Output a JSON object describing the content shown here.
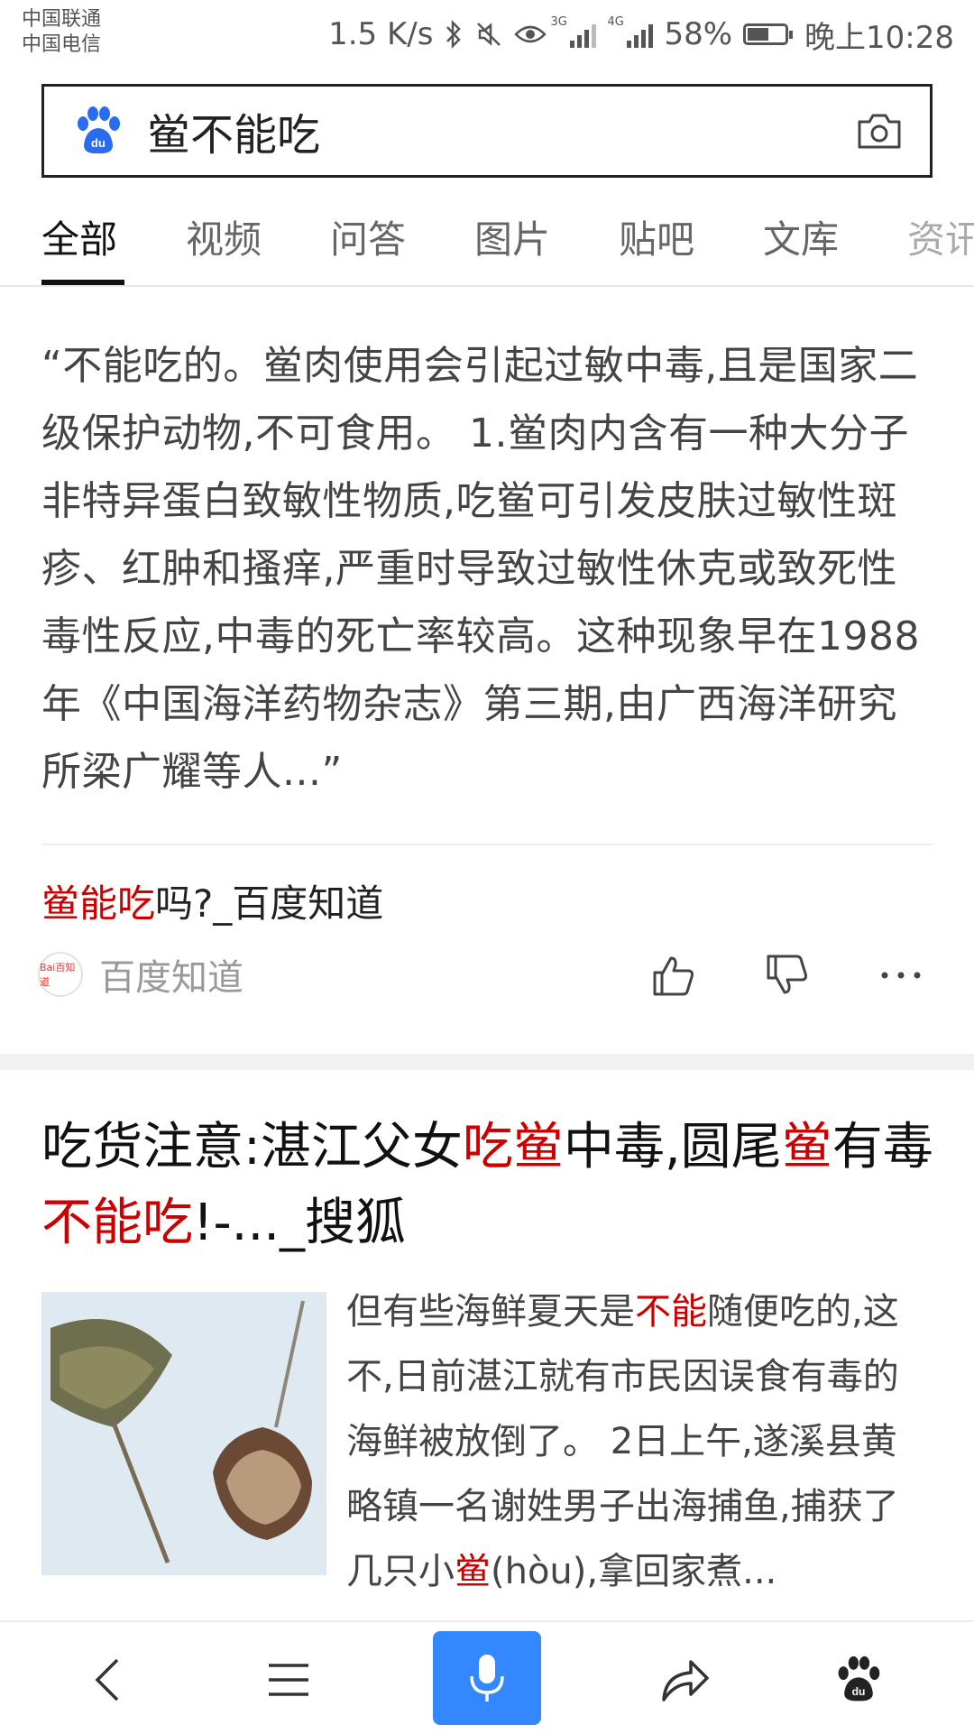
{
  "status_bar": {
    "carrier_1": "中国联通",
    "carrier_2": "中国电信",
    "net_speed": "1.5 K/s",
    "network_3g": "3G",
    "network_4g": "4G",
    "battery": "58%",
    "battery_level": 0.58,
    "time": "晚上10:28"
  },
  "search": {
    "query": "鲎不能吃",
    "logo_text": "du"
  },
  "tabs": [
    "全部",
    "视频",
    "问答",
    "图片",
    "贴吧",
    "文库",
    "资讯"
  ],
  "answer_card": {
    "quote": "“不能吃的。鲎肉使用会引起过敏中毒,且是国家二级保护动物,不可食用。 1.鲎肉内含有一种大分子非特异蛋白致敏性物质,吃鲎可引发皮肤过敏性斑疹、红肿和搔痒,严重时导致过敏性休克或致死性毒性反应,中毒的死亡率较高。这种现象早在1988年《中国海洋药物杂志》第三期,由广西海洋研究所梁广耀等人...”",
    "title_highlight": "鲎能吃",
    "title_rest": "吗?_百度知道",
    "source_logo_text": "Bai百知道",
    "source": "百度知道"
  },
  "news_card": {
    "title_parts": [
      {
        "text": "吃货注意:湛江父女",
        "hl": false
      },
      {
        "text": "吃鲎",
        "hl": true
      },
      {
        "text": "中毒,圆尾",
        "hl": false
      },
      {
        "text": "鲎",
        "hl": true
      },
      {
        "text": "有毒",
        "hl": false
      },
      {
        "text": "不能吃",
        "hl": true
      },
      {
        "text": "!-..._搜狐",
        "hl": false
      }
    ],
    "snippet_parts": [
      {
        "text": "但有些海鲜夏天是",
        "hl": false
      },
      {
        "text": "不能",
        "hl": true
      },
      {
        "text": "随便吃的,这不,日前湛江就有市民因误食有毒的海鲜被放倒了。 2日上午,遂溪县黄略镇一名谢姓男子出海捕鱼,捕获了几只小",
        "hl": false
      },
      {
        "text": "鲎",
        "hl": true
      },
      {
        "text": "(hòu),拿回家煮...",
        "hl": false
      }
    ]
  },
  "bottom_bar": {
    "icons": [
      "back-icon",
      "menu-icon",
      "mic-icon",
      "share-icon",
      "baidu-paw-icon"
    ]
  },
  "colors": {
    "highlight": "#cc0000",
    "accent": "#3388ff",
    "baidu_blue": "#2a6cf0"
  }
}
